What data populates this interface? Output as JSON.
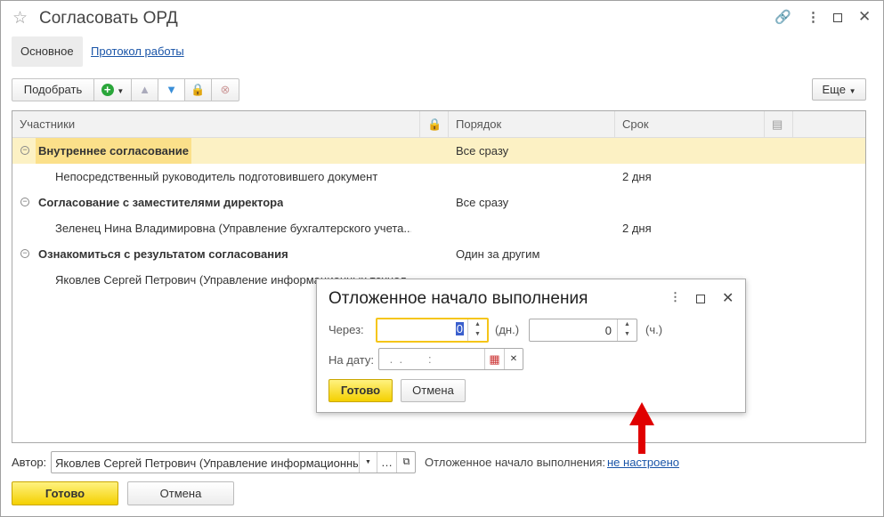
{
  "window": {
    "title": "Согласовать ОРД"
  },
  "tabs": [
    {
      "label": "Основное"
    },
    {
      "label": "Протокол работы"
    }
  ],
  "toolbar": {
    "pick": "Подобрать",
    "more": "Еще"
  },
  "grid": {
    "columns": [
      "Участники",
      "Порядок",
      "Срок"
    ],
    "rows": [
      {
        "participant": "Внутреннее согласование",
        "order": "Все сразу",
        "term": "",
        "group": true
      },
      {
        "participant": "Непосредственный руководитель подготовившего документ",
        "order": "",
        "term": "2 дня",
        "group": false
      },
      {
        "participant": "Согласование с заместителями директора",
        "order": "Все сразу",
        "term": "",
        "group": true
      },
      {
        "participant": "Зеленец Нина Владимировна (Управление бухгалтерского учета...",
        "order": "",
        "term": "2 дня",
        "group": false
      },
      {
        "participant": "Ознакомиться с результатом согласования",
        "order": "Один за другим",
        "term": "",
        "group": true
      },
      {
        "participant": "Яковлев Сергей Петрович (Управление информационных технол",
        "order": "",
        "term": "",
        "group": false
      }
    ]
  },
  "footer": {
    "author_label": "Автор:",
    "author_value": "Яковлев Сергей Петрович (Управление информационных",
    "delayed_label": "Отложенное начало выполнения:",
    "delayed_link": "не настроено",
    "ok": "Готово",
    "cancel": "Отмена"
  },
  "dialog": {
    "title": "Отложенное начало выполнения",
    "through_label": "Через:",
    "days_value": "0",
    "days_unit": "(дн.)",
    "hours_value": "0",
    "hours_unit": "(ч.)",
    "date_label": "На дату:",
    "date_mask": " .  .        :",
    "ok": "Готово",
    "cancel": "Отмена"
  },
  "colors": {
    "accent": "#f4d000",
    "selected_row": "#fcf1c4",
    "link": "#1a55a8",
    "arrow": "#e00000"
  }
}
